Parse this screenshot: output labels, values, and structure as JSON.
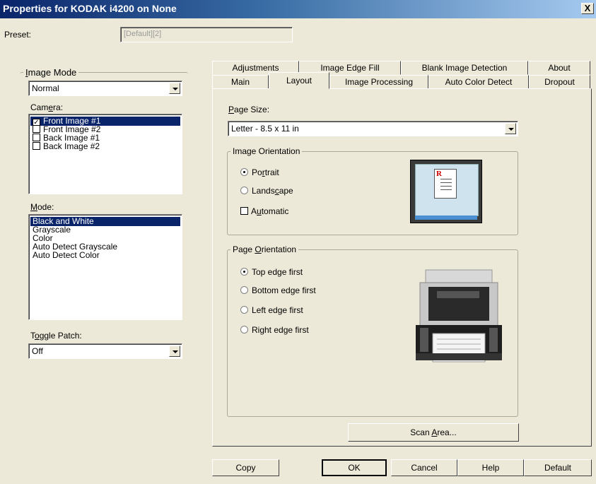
{
  "window": {
    "title": "Properties for KODAK i4200 on None",
    "close_glyph": "X"
  },
  "preset": {
    "label": "Preset:",
    "value": "[Default][2]"
  },
  "image_mode": {
    "group_label": "Image Mode",
    "selected": "Normal",
    "camera_label": "Camera:",
    "cameras": [
      {
        "label": "Front Image #1",
        "checked": true,
        "selected": true
      },
      {
        "label": "Front Image #2",
        "checked": false,
        "selected": false
      },
      {
        "label": "Back Image #1",
        "checked": false,
        "selected": false
      },
      {
        "label": "Back Image #2",
        "checked": false,
        "selected": false
      }
    ],
    "mode_label": "Mode:",
    "modes": [
      {
        "label": "Black and White",
        "selected": true
      },
      {
        "label": "Grayscale",
        "selected": false
      },
      {
        "label": "Color",
        "selected": false
      },
      {
        "label": "Auto Detect Grayscale",
        "selected": false
      },
      {
        "label": "Auto Detect Color",
        "selected": false
      }
    ],
    "toggle_patch_label": "Toggle Patch:",
    "toggle_patch_value": "Off"
  },
  "tabs_row1": [
    "Adjustments",
    "Image Edge Fill",
    "Blank Image Detection",
    "About"
  ],
  "tabs_row2": [
    "Main",
    "Layout",
    "Image Processing",
    "Auto Color Detect",
    "Dropout"
  ],
  "active_tab": "Layout",
  "layout": {
    "page_size_label": "Page Size:",
    "page_size_value": "Letter - 8.5 x 11 in",
    "image_orientation": {
      "label": "Image Orientation",
      "portrait": "Portrait",
      "landscape": "Landscape",
      "automatic": "Automatic",
      "selected": "Portrait",
      "automatic_checked": false,
      "preview_letter": "R"
    },
    "page_orientation": {
      "label": "Page Orientation",
      "options": [
        "Top edge first",
        "Bottom edge first",
        "Left edge first",
        "Right edge first"
      ],
      "selected": "Top edge first"
    },
    "scan_area_button": "Scan Area..."
  },
  "footer": {
    "copy": "Copy",
    "ok": "OK",
    "cancel": "Cancel",
    "help": "Help",
    "default": "Default"
  },
  "colors": {
    "selection": "#0a246a",
    "dialog_bg": "#ece9d8",
    "title_start": "#0a246a",
    "title_end": "#a6caf0"
  }
}
